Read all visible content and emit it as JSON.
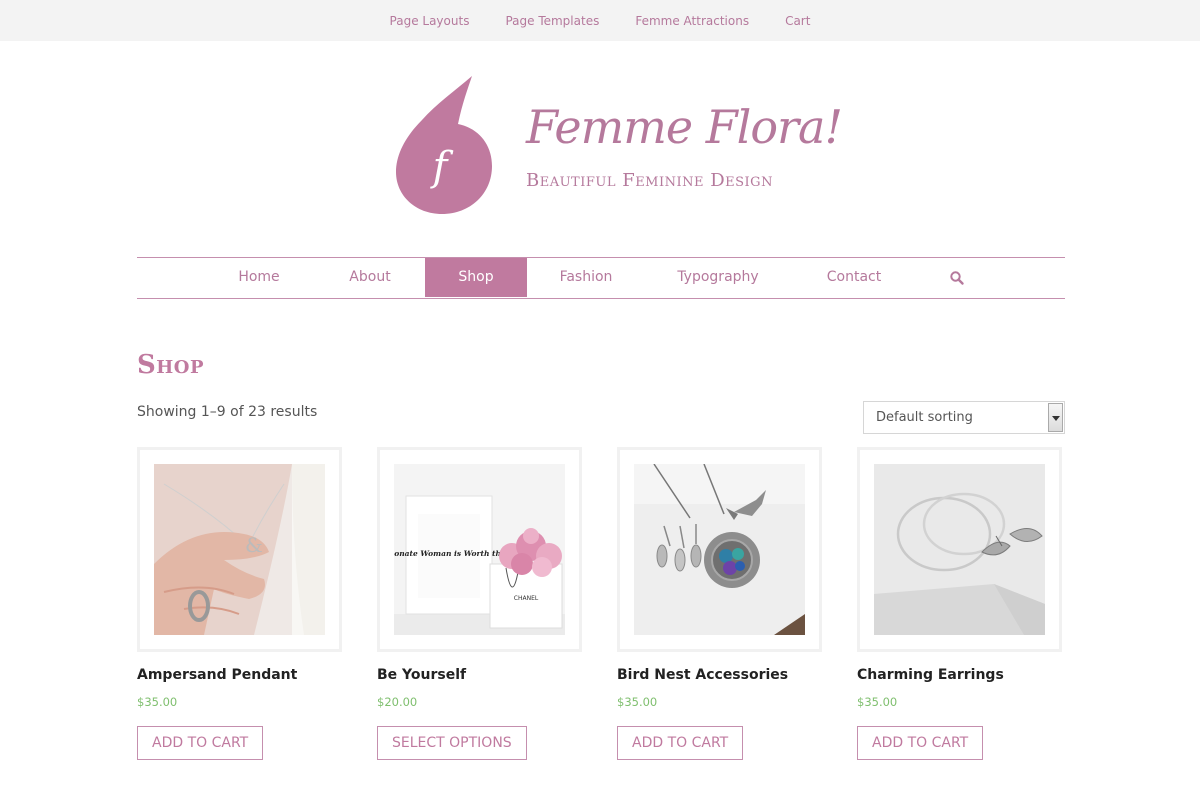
{
  "top_nav": {
    "items": [
      {
        "label": "Page Layouts"
      },
      {
        "label": "Page Templates"
      },
      {
        "label": "Femme Attractions"
      },
      {
        "label": "Cart"
      }
    ]
  },
  "header": {
    "logo_letter": "f",
    "title": "Femme Flora!",
    "tagline": "Beautiful Feminine Design"
  },
  "main_nav": {
    "items": [
      {
        "label": "Home"
      },
      {
        "label": "About"
      },
      {
        "label": "Shop",
        "active": true
      },
      {
        "label": "Fashion"
      },
      {
        "label": "Typography"
      },
      {
        "label": "Contact"
      }
    ],
    "search_icon": "search-icon"
  },
  "shop": {
    "title": "Shop",
    "result_count": "Showing 1–9 of 23 results",
    "sorting": {
      "selected": "Default sorting"
    }
  },
  "products": [
    {
      "name": "Ampersand Pendant",
      "price": "$35.00",
      "button": "ADD TO CART"
    },
    {
      "name": "Be Yourself",
      "price": "$20.00",
      "button": "SELECT OPTIONS",
      "print_text": "A Passionate Woman is Worth the Chaos",
      "bag_text": "CHANEL"
    },
    {
      "name": "Bird Nest Accessories",
      "price": "$35.00",
      "button": "ADD TO CART"
    },
    {
      "name": "Charming Earrings",
      "price": "$35.00",
      "button": "ADD TO CART"
    }
  ],
  "colors": {
    "accent": "#c07a9f",
    "link": "#b5799c",
    "price": "#7fbf6e",
    "topbar_bg": "#f3f3f3"
  }
}
